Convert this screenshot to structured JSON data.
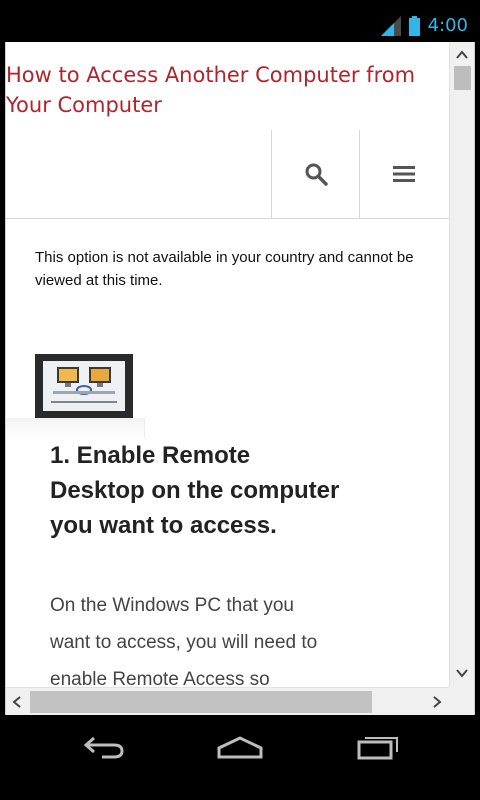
{
  "status_bar": {
    "time": "4:00",
    "icons": [
      "signal-icon",
      "battery-icon"
    ],
    "accent_color": "#33b5e5"
  },
  "page": {
    "title": "How to Access Another Computer from Your Computer",
    "title_color": "#b0242c",
    "nav": {
      "icons": [
        "search-icon",
        "menu-icon"
      ]
    },
    "notice_lines": [
      "This option is not available in your country and cannot be",
      "viewed at this time."
    ],
    "step": {
      "heading": "1. Enable Remote Desktop on the computer you want to access.",
      "body": "On the Windows PC that you want to access, you will need to enable Remote Access so"
    }
  },
  "system_nav": {
    "icons": [
      "back-icon",
      "home-icon",
      "recent-apps-icon"
    ]
  }
}
